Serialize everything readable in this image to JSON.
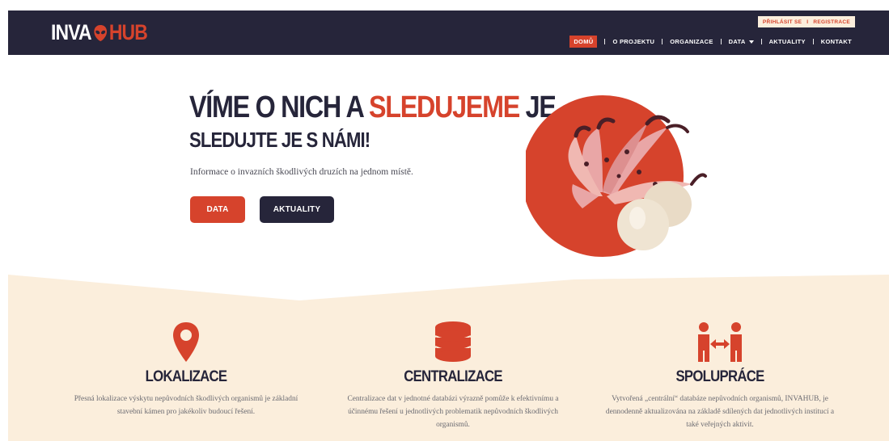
{
  "brand": {
    "logo_left": "INVA",
    "logo_right": "HUB",
    "logo_icon": "alien-head-icon",
    "accent_color": "#d6432c",
    "dark_color": "#26253a",
    "beige_color": "#fbeedc"
  },
  "auth": {
    "login": "PŘIHLÁSIT SE",
    "separator": "I",
    "register": "REGISTRACE"
  },
  "nav": {
    "items": [
      "DOMŮ",
      "O PROJEKTU",
      "ORGANIZACE",
      "DATA",
      "AKTUALITY",
      "KONTAKT"
    ],
    "active": "DOMŮ"
  },
  "hero": {
    "headline_part1": "VÍME O NICH A ",
    "headline_red": "SLEDUJEME",
    "headline_part2": " JE.",
    "subheadline": "SLEDUJTE JE S NÁMI!",
    "intro": "Informace o invazních škodlivých druzích na jednom místě.",
    "btn_data": "DATA",
    "btn_news": "AKTUALITY"
  },
  "features": [
    {
      "icon": "map-pin-icon",
      "title": "LOKALIZACE",
      "text": "Přesná lokalizace výskytu nepůvodních škodlivých organismů je základní stavební kámen pro jakékoliv budoucí řešení."
    },
    {
      "icon": "database-icon",
      "title": "CENTRALIZACE",
      "text": "Centralizace dat v jednotné databázi výrazně pomůže k efektivnímu a účinnému řešení u jednotlivých problematik nepůvodních škodlivých organismů."
    },
    {
      "icon": "collaboration-icon",
      "title": "SPOLUPRÁCE",
      "text": "Vytvořená „centrální“ databáze nepůvodních organismů, INVAHUB, je dennodenně aktualizována na základě sdílených dat jednotlivých institucí a také veřejných aktivit."
    }
  ]
}
